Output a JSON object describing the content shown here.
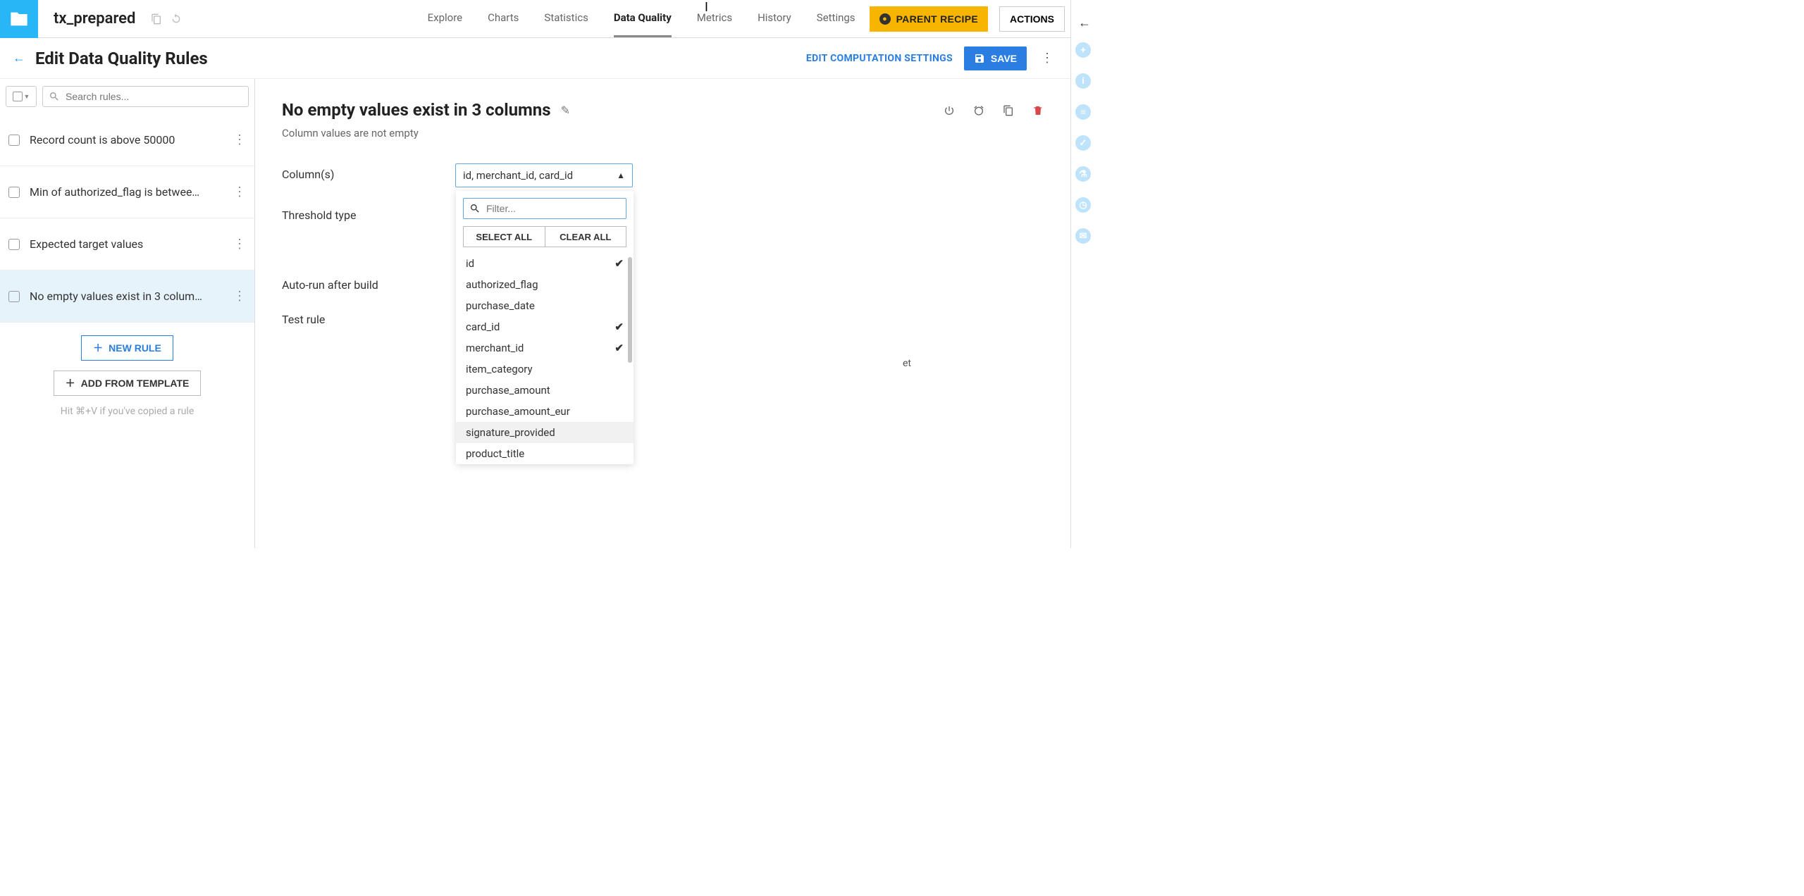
{
  "header": {
    "dataset_name": "tx_prepared",
    "nav": [
      "Explore",
      "Charts",
      "Statistics",
      "Data Quality",
      "Metrics",
      "History",
      "Settings"
    ],
    "nav_active_index": 3,
    "parent_recipe_label": "PARENT RECIPE",
    "actions_label": "ACTIONS"
  },
  "subheader": {
    "title": "Edit Data Quality Rules",
    "edit_settings_label": "EDIT COMPUTATION SETTINGS",
    "save_label": "SAVE"
  },
  "rules_panel": {
    "search_placeholder": "Search rules...",
    "rules": [
      {
        "label": "Record count is above 50000",
        "selected": false
      },
      {
        "label": "Min of authorized_flag is betwee…",
        "selected": false
      },
      {
        "label": "Expected target values",
        "selected": false
      },
      {
        "label": "No empty values exist in 3 colum…",
        "selected": true
      }
    ],
    "new_rule_label": "NEW RULE",
    "add_template_label": "ADD FROM TEMPLATE",
    "hint": "Hit ⌘+V if you've copied a rule"
  },
  "editor": {
    "title": "No empty values exist in 3 columns",
    "subtitle": "Column values are not empty",
    "labels": {
      "columns": "Column(s)",
      "threshold": "Threshold type",
      "autorun": "Auto-run after build",
      "test": "Test rule"
    },
    "combo_value": "id, merchant_id, card_id",
    "et_suffix": "et"
  },
  "dropdown": {
    "filter_placeholder": "Filter...",
    "select_all": "SELECT ALL",
    "clear_all": "CLEAR ALL",
    "items": [
      {
        "name": "id",
        "checked": true,
        "hover": false
      },
      {
        "name": "authorized_flag",
        "checked": false,
        "hover": false
      },
      {
        "name": "purchase_date",
        "checked": false,
        "hover": false
      },
      {
        "name": "card_id",
        "checked": true,
        "hover": false
      },
      {
        "name": "merchant_id",
        "checked": true,
        "hover": false
      },
      {
        "name": "item_category",
        "checked": false,
        "hover": false
      },
      {
        "name": "purchase_amount",
        "checked": false,
        "hover": false
      },
      {
        "name": "purchase_amount_eur",
        "checked": false,
        "hover": false
      },
      {
        "name": "signature_provided",
        "checked": false,
        "hover": true
      },
      {
        "name": "product_title",
        "checked": false,
        "hover": false
      }
    ]
  }
}
